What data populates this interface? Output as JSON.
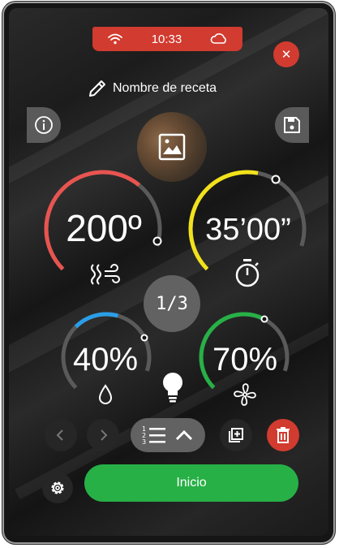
{
  "status": {
    "time": "10:33",
    "wifi_icon": "wifi-icon",
    "cloud_icon": "cloud-icon",
    "color": "#d23b2f"
  },
  "recipe": {
    "name": "Nombre de receta",
    "edit_icon": "pencil-icon"
  },
  "gauges": {
    "temperature": {
      "value": "200º",
      "level": 0.72,
      "color": "#e85450",
      "icon": "steam-heat-icon"
    },
    "time": {
      "value": "35’00”",
      "level": 0.6,
      "color": "#f2e21b",
      "icon": "timer-icon"
    },
    "humidity": {
      "value": "40%",
      "level": 0.4,
      "color": "#2a9ee8",
      "icon": "drop-icon"
    },
    "fan": {
      "value": "70%",
      "level": 0.7,
      "color": "#27b046",
      "icon": "fan-icon"
    }
  },
  "step": {
    "label": "1/3"
  },
  "actions": {
    "start_label": "Inicio"
  },
  "colors": {
    "accent_red": "#d23b2f",
    "accent_green": "#27b046",
    "neutral": "#626262"
  }
}
